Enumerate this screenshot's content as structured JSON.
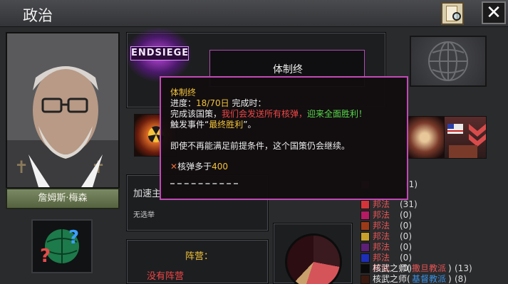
{
  "window": {
    "title": "政治",
    "close_label": "✕"
  },
  "leader": {
    "name": "詹姆斯·梅森"
  },
  "focus": {
    "badge": "ENDSIEGE",
    "name": "体制终"
  },
  "tooltip": {
    "title": "体制终",
    "progress_label": "进度：",
    "progress_value": "18/70日",
    "completion_label": "完成时：",
    "line2_a": "完成该国策，",
    "line2_b": "我们会发送所有核弹，",
    "line2_c": "迎来全面胜利！",
    "line3_a": "触发事件“",
    "line3_b": "最终胜利",
    "line3_c": "”。",
    "line4": "即使不再能满足前提条件，这个国策仍会继续。",
    "cond_mark": "✕",
    "cond_text": "核弹多于",
    "cond_value": "400"
  },
  "effect_panel": {
    "title": "加速主",
    "subtitle": "无选举"
  },
  "faction_panel": {
    "label": "阵营：",
    "value": "没有阵营"
  },
  "legend": {
    "items": [
      {
        "label": "",
        "count": "(1)",
        "color": "#7a1d22"
      },
      {
        "label": "邦法",
        "count": "(31)",
        "color": "#d3343a"
      },
      {
        "label": "邦法",
        "count": "(0)",
        "color": "#b51a63"
      },
      {
        "label": "邦法",
        "count": "(0)",
        "color": "#9c3a18"
      },
      {
        "label": "邦法",
        "count": "(0)",
        "color": "#c9a12a"
      },
      {
        "label": "邦法",
        "count": "(0)",
        "color": "#5e1f78"
      },
      {
        "label": "邦法",
        "count": "(0)",
        "color": "#1d2fb8"
      },
      {
        "label": "邦法",
        "count": "(0)",
        "color": "#4a4a52"
      },
      {
        "label": "核武之师",
        "sub": "撒旦教派",
        "count": "(13)",
        "color": "#0a0a0a"
      },
      {
        "label": "核武之师",
        "sub": "基督教派",
        "count": "(8)",
        "color": "#3a1a10"
      }
    ]
  }
}
